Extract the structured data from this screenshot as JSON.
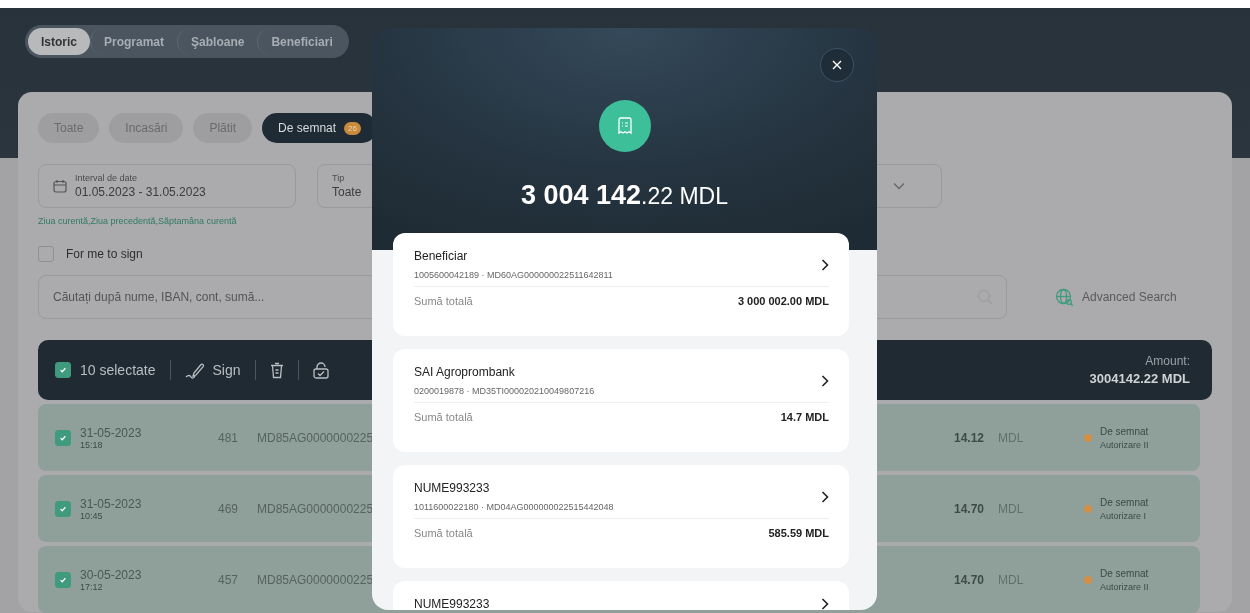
{
  "tabs": [
    {
      "label": "Istoric",
      "selected": true
    },
    {
      "label": "Programat",
      "selected": false
    },
    {
      "label": "Şabloane",
      "selected": false
    },
    {
      "label": "Beneficiari",
      "selected": false
    }
  ],
  "filter_chips": [
    {
      "label": "Toate",
      "selected": false
    },
    {
      "label": "Incasări",
      "selected": false
    },
    {
      "label": "Plătit",
      "selected": false
    },
    {
      "label": "De semnat",
      "selected": true,
      "badge": "26"
    }
  ],
  "date_field": {
    "label": "Interval de date",
    "value": "01.05.2023 - 31.05.2023"
  },
  "type_field": {
    "label": "Tip",
    "value": "Toate"
  },
  "quick_ranges": "Ziua curentă,Ziua precedentă,Săptamâna curentă",
  "for_me_to_sign": {
    "label": "For me to sign",
    "checked": false
  },
  "search": {
    "placeholder": "Căutați după nume, IBAN, cont, sumă..."
  },
  "advanced_search": "Advanced Search",
  "selection_bar": {
    "checked": true,
    "count_label": "10 selectate",
    "sign": "Sign",
    "amount_label": "Amount:",
    "amount": "3004142.22 MDL"
  },
  "rows": [
    {
      "checked": true,
      "date": "31-05-2023",
      "time": "15:18",
      "number": "481",
      "iban": "MD85AG0000000225",
      "amount": "14.12",
      "currency": "MDL",
      "status": "De semnat",
      "authorization": "Autorizare II"
    },
    {
      "checked": true,
      "date": "31-05-2023",
      "time": "10:45",
      "number": "469",
      "iban": "MD85AG0000000225",
      "amount": "14.70",
      "currency": "MDL",
      "status": "De semnat",
      "authorization": "Autorizare I"
    },
    {
      "checked": true,
      "date": "30-05-2023",
      "time": "17:12",
      "number": "457",
      "iban": "MD85AG0000000225",
      "amount": "14.70",
      "currency": "MDL",
      "status": "De semnat",
      "authorization": "Autorizare II"
    }
  ],
  "modal": {
    "total": "**3 004 142**.22 MDL",
    "items": [
      {
        "name": "Beneficiar",
        "details": "1005600042189 · MD60AG000000022511642811",
        "sum_label": "Sumă totală",
        "sum": "3 000 002.00 MDL"
      },
      {
        "name": "SAI Agroprombank",
        "details": "0200019878 · MD35TI000020210049807216",
        "sum_label": "Sumă totală",
        "sum": "14.7 MDL"
      },
      {
        "name": "NUME993233",
        "details": "1011600022180 · MD04AG000000022515442048",
        "sum_label": "Sumă totală",
        "sum": "585.59 MDL"
      },
      {
        "name": "NUME993233"
      }
    ]
  }
}
